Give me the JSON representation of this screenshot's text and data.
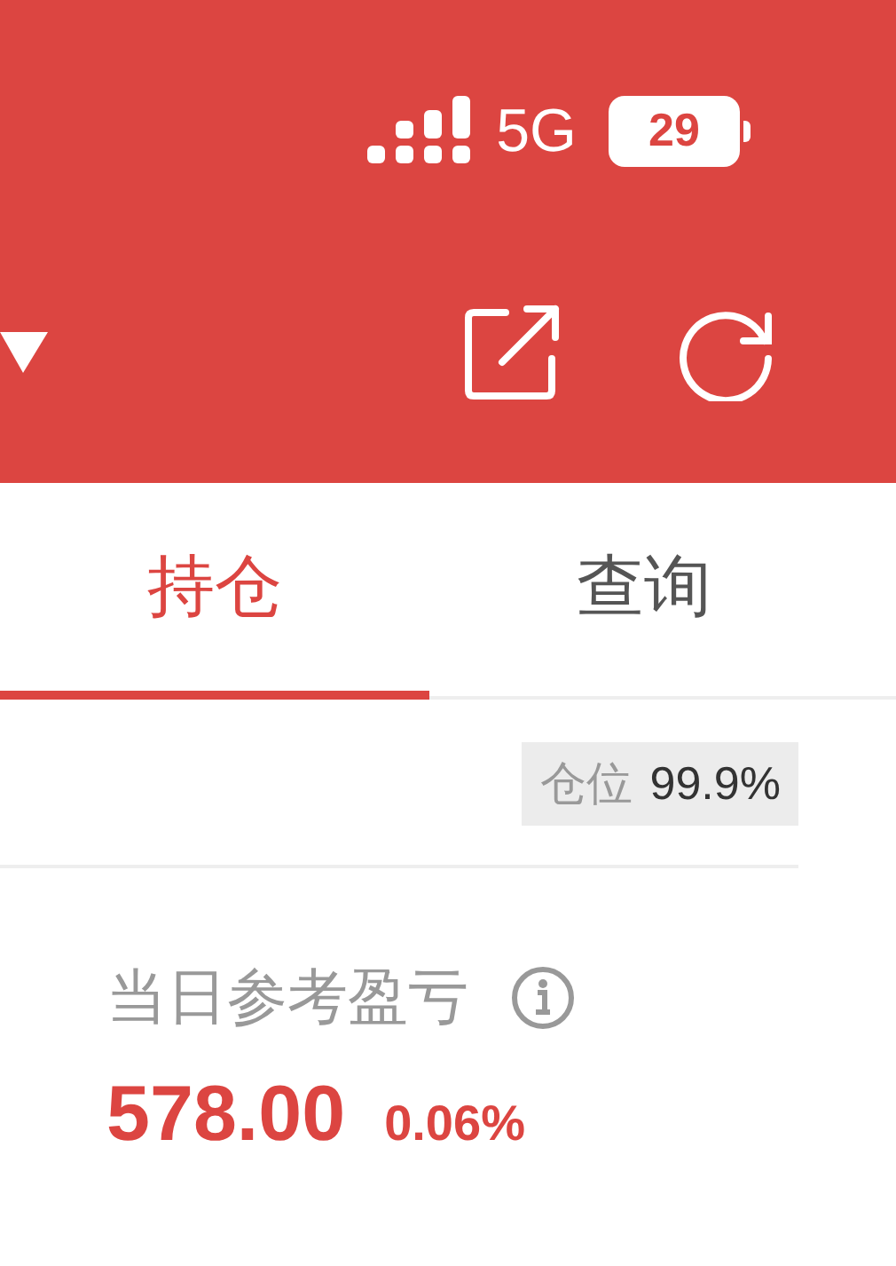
{
  "status_bar": {
    "network": "5G",
    "battery": "29"
  },
  "tabs": [
    {
      "label": "持仓",
      "selected": true
    },
    {
      "label": "查询",
      "selected": false
    }
  ],
  "position": {
    "label": "仓位",
    "value": "99.9%"
  },
  "daily_pnl": {
    "label": "当日参考盈亏",
    "value": "578.00",
    "percent": "0.06%"
  }
}
